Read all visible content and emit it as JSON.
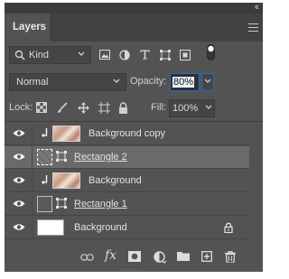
{
  "panel": {
    "tab_label": "Layers"
  },
  "filter": {
    "kind_label": "Kind",
    "filter_icons": [
      "pixel-layer-filter-icon",
      "adjustment-layer-filter-icon",
      "type-layer-filter-icon",
      "shape-layer-filter-icon",
      "smart-object-filter-icon",
      "filter-toggle-icon"
    ]
  },
  "blend": {
    "mode_label": "Normal",
    "opacity_label": "Opacity:",
    "opacity_value": "80%"
  },
  "lock": {
    "label": "Lock:",
    "icons": [
      "lock-transparent-pixels-icon",
      "lock-image-pixels-icon",
      "lock-position-icon",
      "lock-artboard-icon",
      "lock-all-icon"
    ],
    "fill_label": "Fill:",
    "fill_value": "100%"
  },
  "layers": [
    {
      "name": "Background copy",
      "clipped": true,
      "thumb": "photo",
      "selected": false,
      "underlined": false
    },
    {
      "name": "Rectangle 2",
      "clipped": false,
      "thumb": "shape-dashed",
      "selected": true,
      "underlined": true
    },
    {
      "name": "Background",
      "clipped": true,
      "thumb": "photo",
      "selected": false,
      "underlined": false
    },
    {
      "name": "Rectangle 1",
      "clipped": false,
      "thumb": "shape",
      "selected": false,
      "underlined": true
    },
    {
      "name": "Background",
      "clipped": false,
      "thumb": "white",
      "selected": false,
      "underlined": false,
      "locked": true
    }
  ],
  "bottom_icons": [
    "link-layers-icon",
    "layer-style-fx-icon",
    "layer-mask-icon",
    "adjustment-layer-icon",
    "new-group-folder-icon",
    "new-layer-icon",
    "delete-layer-icon"
  ],
  "bottom": {
    "fx_label": "fx"
  }
}
